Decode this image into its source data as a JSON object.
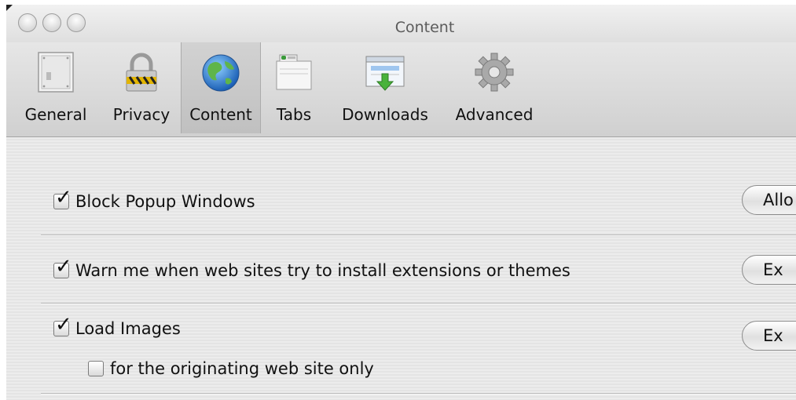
{
  "window": {
    "title": "Content"
  },
  "toolbar": {
    "items": [
      {
        "label": "General",
        "icon": "general-switch-icon"
      },
      {
        "label": "Privacy",
        "icon": "lock-icon"
      },
      {
        "label": "Content",
        "icon": "globe-icon",
        "selected": true
      },
      {
        "label": "Tabs",
        "icon": "tabs-icon"
      },
      {
        "label": "Downloads",
        "icon": "download-icon"
      },
      {
        "label": "Advanced",
        "icon": "gear-icon"
      }
    ]
  },
  "content": {
    "block_popups": {
      "label": "Block Popup Windows",
      "checked": true,
      "button": "Allo"
    },
    "warn_extensions": {
      "label": "Warn me when web sites try to install extensions or themes",
      "checked": true,
      "button": "Ex"
    },
    "load_images": {
      "label": "Load Images",
      "checked": true,
      "button": "Ex"
    },
    "originating_only": {
      "label": "for the originating web site only",
      "checked": false
    }
  }
}
